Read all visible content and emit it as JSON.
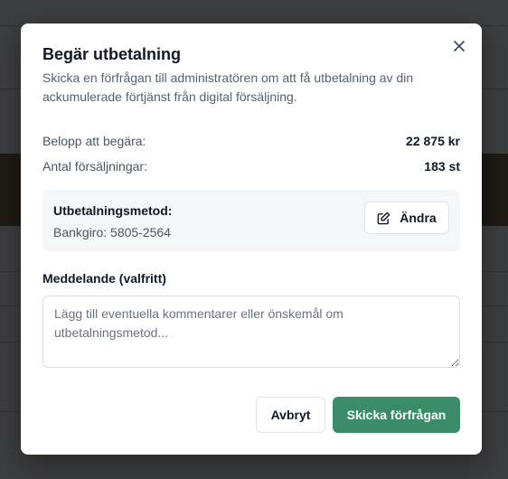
{
  "modal": {
    "title": "Begär utbetalning",
    "subtitle": "Skicka en förfrågan till administratören om att få utbetalning av din ackumulerade förtjänst från digital försäljning.",
    "close_icon": "close-icon"
  },
  "summary": [
    {
      "label": "Belopp att begära:",
      "value": "22 875 kr"
    },
    {
      "label": "Antal försäljningar:",
      "value": "183 st"
    }
  ],
  "payout_method": {
    "label": "Utbetalningsmetod:",
    "value": "Bankgiro: 5805-2564",
    "edit_label": "Ändra",
    "edit_icon": "edit-icon"
  },
  "message": {
    "label": "Meddelande (valfritt)",
    "placeholder": "Lägg till eventuella kommentarer eller önskemål om utbetalningsmetod...",
    "value": ""
  },
  "actions": {
    "cancel_label": "Avbryt",
    "submit_label": "Skicka förfrågan"
  },
  "colors": {
    "primary": "#3a8c68",
    "overlay": "#3c3d3f"
  }
}
